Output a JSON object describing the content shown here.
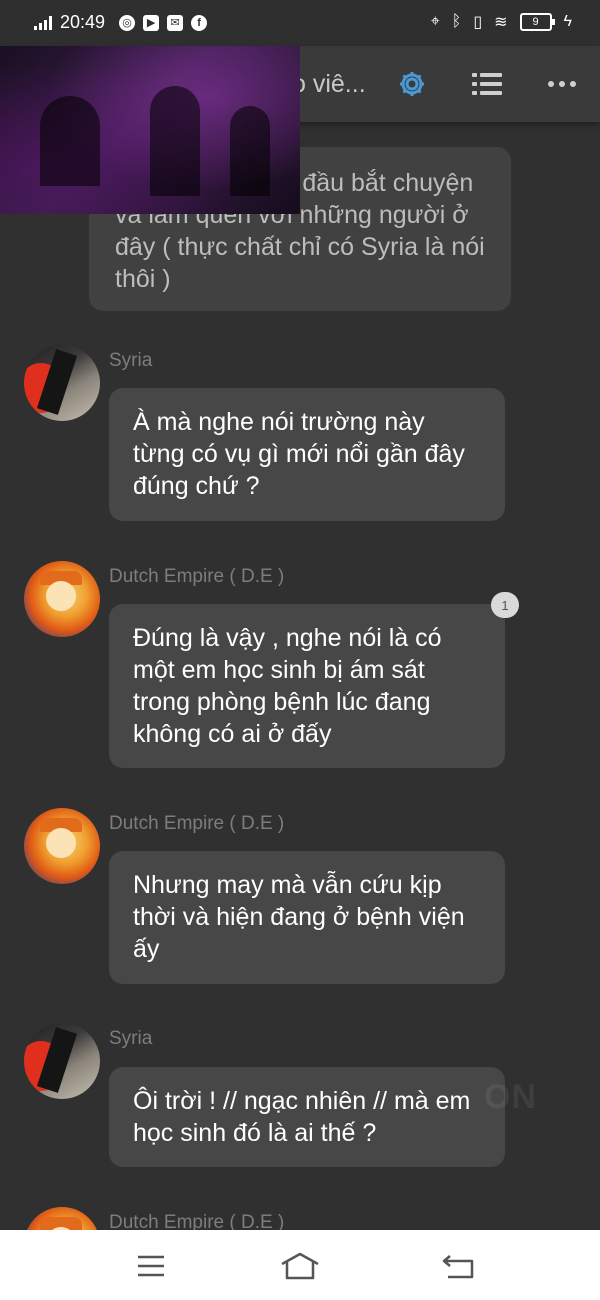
{
  "status_bar": {
    "time": "20:49",
    "battery": "9"
  },
  "header": {
    "title": "o viê..."
  },
  "messages": [
    {
      "text": "...ơi họ cũng bắt đầu bắt chuyện và làm quen với những người ở đây ( thực chất chỉ có Syria là nói thôi )"
    },
    {
      "sender": "Syria",
      "text": "À mà nghe nói trường này từng có vụ gì mới nổi gần đây đúng chứ ?"
    },
    {
      "sender": "Dutch Empire ( D.E )",
      "text": "Đúng là vậy , nghe nói là có một em học sinh bị ám sát trong phòng bệnh lúc đang không có ai ở đấy",
      "badge": "1"
    },
    {
      "sender": "Dutch Empire ( D.E )",
      "text": "Nhưng may mà vẫn cứu kịp thời và hiện đang ở bệnh viện ấy"
    },
    {
      "sender": "Syria",
      "text": "Ôi trời ! // ngạc nhiên // mà em học sinh đó là ai thế ?"
    },
    {
      "sender": "Dutch Empire ( D.E )"
    }
  ],
  "watermark": "ON",
  "colors": {
    "accent": "#4a9ad8",
    "background": "#303030",
    "bubble": "#474747"
  }
}
